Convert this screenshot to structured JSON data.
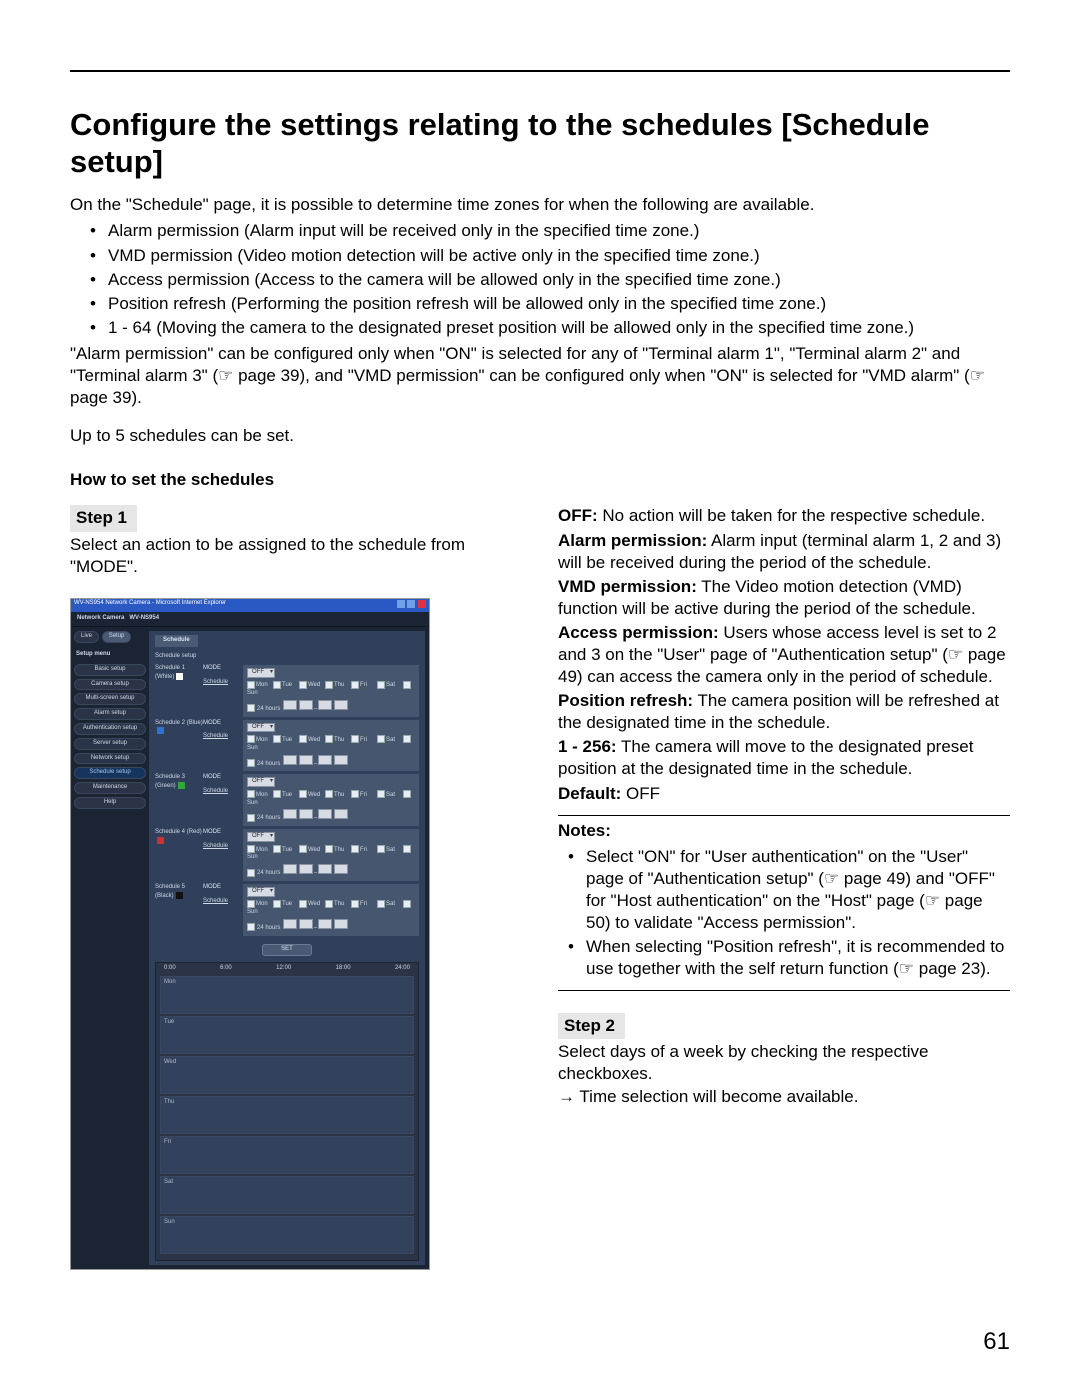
{
  "title": "Configure the settings relating to the schedules [Schedule setup]",
  "intro_line": "On the \"Schedule\" page, it is possible to determine time zones for when the following are available.",
  "bullets": [
    "Alarm permission (Alarm input will be received only in the specified time zone.)",
    "VMD permission (Video motion detection will be active only in the specified time zone.)",
    "Access permission (Access to the camera will be allowed only in the specified time zone.)",
    "Position refresh (Performing the position refresh will be allowed only in the specified time zone.)",
    "1 - 64 (Moving the camera to the designated preset position will be allowed only in the specified time zone.)"
  ],
  "after1": "\"Alarm permission\" can be configured only when \"ON\" is selected for any of \"Terminal alarm 1\", \"Terminal alarm 2\" and \"Terminal alarm 3\" (☞ page 39), and \"VMD permission\" can be configured only when \"ON\" is selected for \"VMD alarm\" (☞ page 39).",
  "after2": "Up to 5 schedules can be set.",
  "howto": "How to set the schedules",
  "step1": "Step 1",
  "step1_text": "Select an action to be assigned to the schedule from \"MODE\".",
  "options": {
    "off_label": "OFF:",
    "off_text": " No action will be taken for the respective schedule.",
    "alarm_label": "Alarm permission:",
    "alarm_text": " Alarm input (terminal alarm 1, 2 and 3) will be received during the period of the schedule.",
    "vmd_label": "VMD permission:",
    "vmd_text": " The Video motion detection (VMD) function will be active during the period of the schedule.",
    "access_label": "Access permission:",
    "access_text": " Users whose access level is set to 2 and 3 on the \"User\" page of \"Authentication setup\" (☞ page 49) can access the camera only in the period of schedule.",
    "pos_label": "Position refresh:",
    "pos_text": " The camera position will be refreshed at the designated time in the schedule.",
    "range_label": "1 - 256:",
    "range_text": " The camera will move to the designated preset position at the designated time in the schedule.",
    "default_label": "Default:",
    "default_value": " OFF"
  },
  "notes_head": "Notes:",
  "notes": [
    "Select \"ON\" for \"User authentication\" on the \"User\" page of \"Authentication setup\" (☞ page 49) and \"OFF\" for \"Host authentication\" on the \"Host\" page (☞ page 50) to validate \"Access permission\".",
    "When selecting \"Position refresh\", it is recommended to use together with the self return function (☞ page 23)."
  ],
  "step2": "Step 2",
  "step2_text": "Select days of a week by checking the respective checkboxes.",
  "step2_text2": "→ Time selection will become available.",
  "page_number": "61",
  "shot": {
    "window_title": "WV-NS954 Network Camera - Microsoft Internet Explorer",
    "model": "WV-NS954",
    "brand": "Network Camera",
    "live": "Live",
    "setup": "Setup",
    "menu_head": "Setup menu",
    "menu": [
      "Basic setup",
      "Camera setup",
      "Multi-screen setup",
      "Alarm setup",
      "Authentication setup",
      "Server setup",
      "Network setup",
      "Schedule setup",
      "Maintenance",
      "Help"
    ],
    "tab": "Schedule",
    "section": "Schedule setup",
    "mode": "MODE",
    "sched_link": "Schedule",
    "off": "OFF",
    "days": [
      "Mon",
      "Tue",
      "Wed",
      "Thu",
      "Fri",
      "Sat",
      "Sun"
    ],
    "h24": "24 hours",
    "set": "SET",
    "times": [
      "0:00",
      "6:00",
      "12:00",
      "18:00",
      "24:00"
    ],
    "sched_labels": [
      "Schedule 1 (White)",
      "Schedule 2 (Blue)",
      "Schedule 3 (Green)",
      "Schedule 4 (Red)",
      "Schedule 5 (Black)"
    ]
  }
}
